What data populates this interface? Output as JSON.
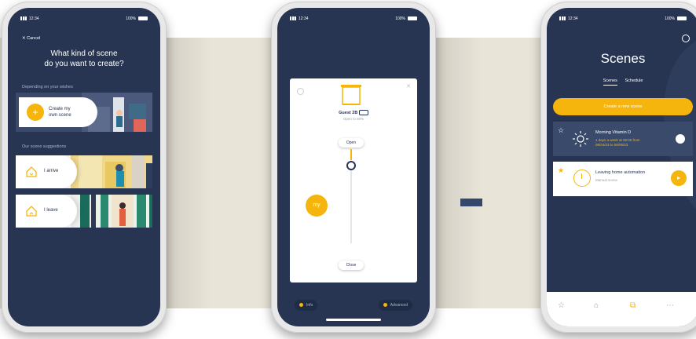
{
  "colors": {
    "navy": "#273552",
    "accent": "#f5b50d",
    "band": "#e9e4d8"
  },
  "status_bar": {
    "time": "12:34",
    "battery": "100%"
  },
  "phone1": {
    "cancel_label": "Cancel",
    "title_line1": "What kind of scene",
    "title_line2": "do you want to create?",
    "section1_label": "Depending on your wishes",
    "create_card": {
      "line1": "Create my",
      "line2": "own scene",
      "icon": "plus-icon"
    },
    "section2_label": "Our scene suggestions",
    "suggestions": [
      {
        "label": "I arrive",
        "icon": "house-arrive-icon"
      },
      {
        "label": "I leave",
        "icon": "house-leave-icon"
      }
    ]
  },
  "phone2": {
    "device_name": "Guest 2B",
    "device_status": "Open to 80%",
    "open_label": "Open",
    "close_label": "Close",
    "my_label": "my",
    "position_percent": 80,
    "bottom_left": "Info",
    "bottom_right": "Advanced"
  },
  "phone3": {
    "title": "Scenes",
    "tabs": [
      "Scenes",
      "Schedule"
    ],
    "create_button": "Create a new scene",
    "scenes": [
      {
        "name": "Morning Vitamin D",
        "detail_line1": "1 days a week at 08:00 from",
        "detail_line2": "06/04/23 to 06/05/23",
        "icon": "sun-icon",
        "favorite": false,
        "enabled": true
      },
      {
        "name": "Leaving home automation",
        "detail_line1": "Manual scene",
        "detail_line2": "",
        "icon": "clock-icon",
        "favorite": true
      }
    ],
    "tabbar": [
      "star-icon",
      "home-icon",
      "scenes-icon",
      "more-icon"
    ]
  }
}
